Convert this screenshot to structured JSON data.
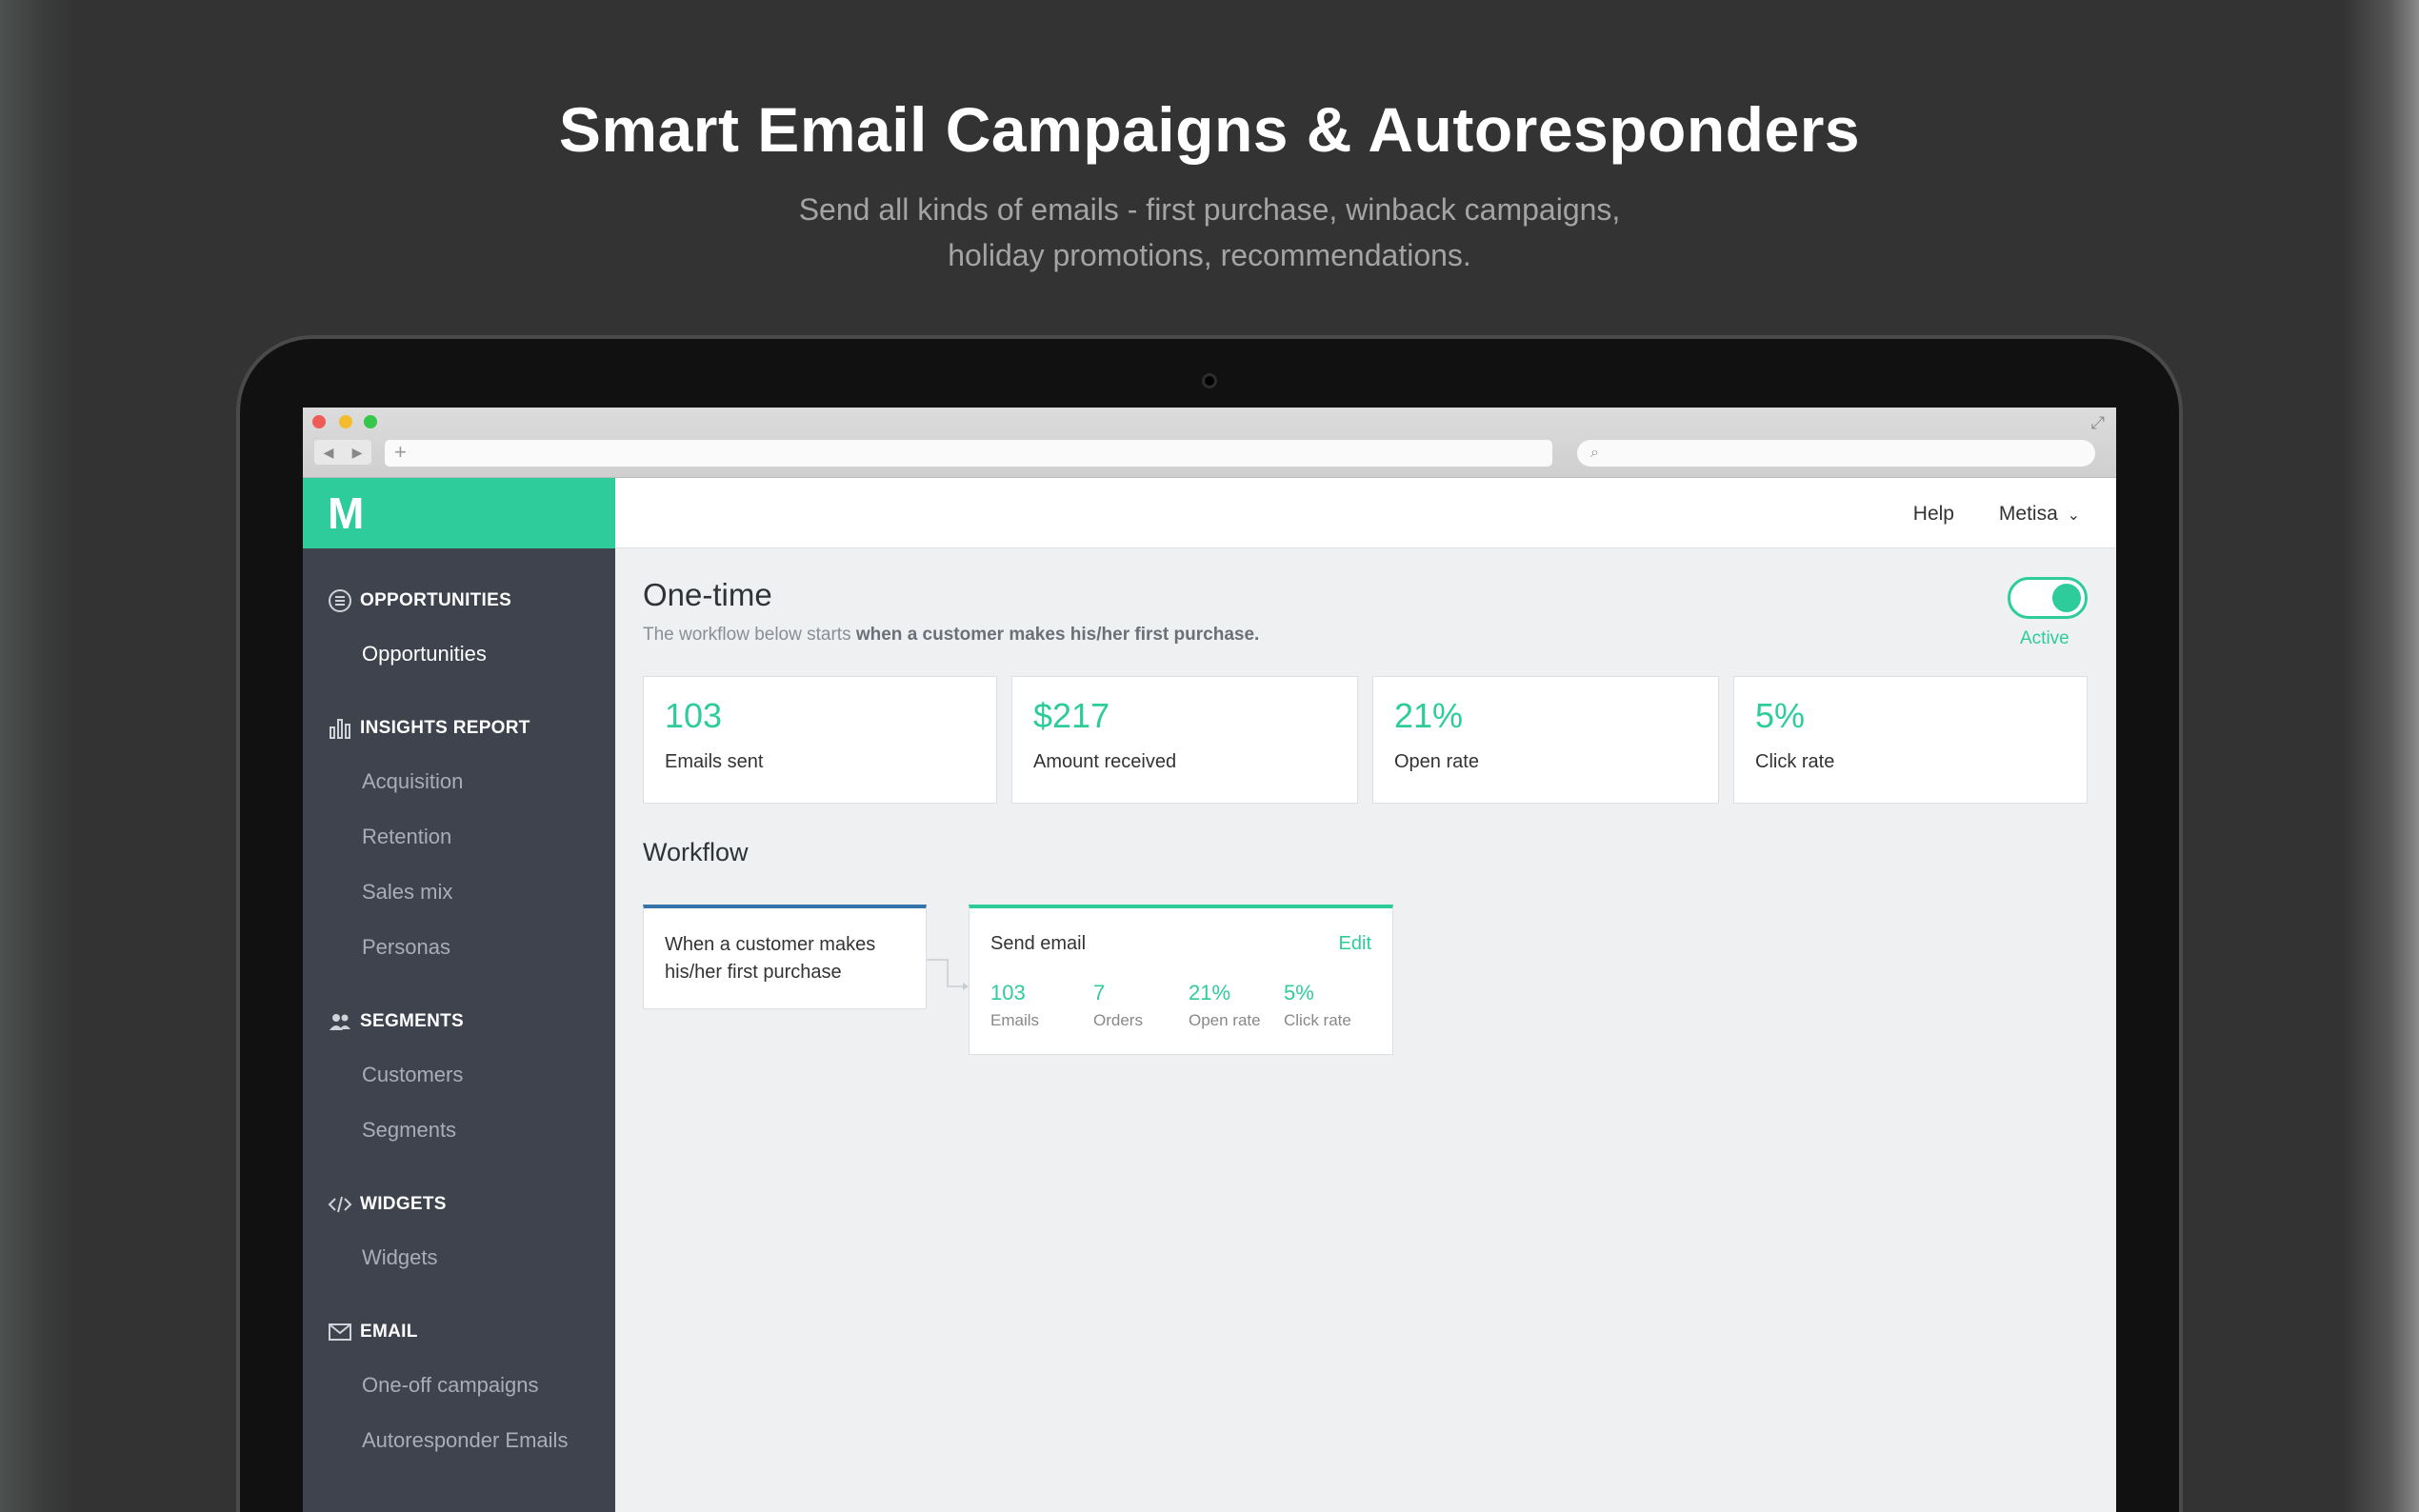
{
  "header": {
    "title": "Smart Email Campaigns & Autoresponders",
    "subtitle_line1": "Send all kinds of emails - first purchase, winback campaigns,",
    "subtitle_line2": "holiday promotions, recommendations."
  },
  "browser": {
    "back": "◀",
    "forward": "▶",
    "new_tab": "+",
    "search_icon": "⌕",
    "expand_icon": "⤢"
  },
  "app": {
    "logo": "M",
    "help_label": "Help",
    "user_name": "Metisa",
    "user_caret": "⌄"
  },
  "sidebar": {
    "sections": [
      {
        "title": "OPPORTUNITIES",
        "icon": "list-circle-icon",
        "items": [
          "Opportunities"
        ]
      },
      {
        "title": "INSIGHTS REPORT",
        "icon": "bar-chart-icon",
        "items": [
          "Acquisition",
          "Retention",
          "Sales mix",
          "Personas"
        ]
      },
      {
        "title": "SEGMENTS",
        "icon": "users-icon",
        "items": [
          "Customers",
          "Segments"
        ]
      },
      {
        "title": "WIDGETS",
        "icon": "code-icon",
        "items": [
          "Widgets"
        ]
      },
      {
        "title": "EMAIL",
        "icon": "envelope-icon",
        "items": [
          "One-off campaigns",
          "Autoresponder Emails"
        ]
      }
    ]
  },
  "main": {
    "title": "One-time",
    "desc_prefix": "The workflow below starts ",
    "desc_bold": "when a customer makes his/her first purchase.",
    "toggle_label": "Active",
    "stats": [
      {
        "value": "103",
        "label": "Emails sent"
      },
      {
        "value": "$217",
        "label": "Amount received"
      },
      {
        "value": "21%",
        "label": "Open rate"
      },
      {
        "value": "5%",
        "label": "Click rate"
      }
    ],
    "workflow_title": "Workflow",
    "trigger_text": "When a customer makes his/her first purchase",
    "send": {
      "title": "Send email",
      "edit_label": "Edit",
      "metrics": [
        {
          "value": "103",
          "label": "Emails"
        },
        {
          "value": "7",
          "label": "Orders"
        },
        {
          "value": "21%",
          "label": "Open rate"
        },
        {
          "value": "5%",
          "label": "Click rate"
        }
      ]
    }
  },
  "colors": {
    "accent": "#2ecc9a",
    "sidebar_bg": "#3f434e",
    "trigger_border": "#3574a8"
  }
}
